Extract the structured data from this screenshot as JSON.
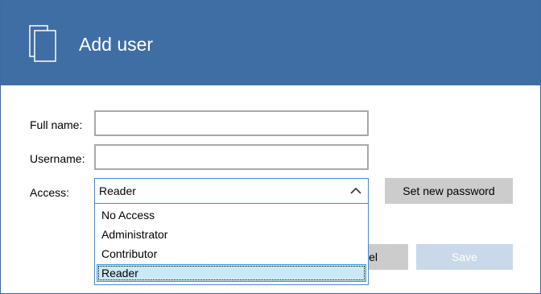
{
  "header": {
    "title": "Add user",
    "icon": "documents-icon",
    "background_color": "#3f6ea4"
  },
  "form": {
    "full_name": {
      "label": "Full name:",
      "value": ""
    },
    "username": {
      "label": "Username:",
      "value": ""
    },
    "access": {
      "label": "Access:",
      "selected": "Reader",
      "expanded": true,
      "options": [
        "No Access",
        "Administrator",
        "Contributor",
        "Reader"
      ]
    }
  },
  "buttons": {
    "set_password": "Set new password",
    "cancel": "el",
    "save": "Save"
  },
  "colors": {
    "accent": "#4e87c7",
    "selected_item": "#cbe8f6",
    "button_gray": "#cccccc",
    "disabled_save": "#c9d9ea"
  }
}
